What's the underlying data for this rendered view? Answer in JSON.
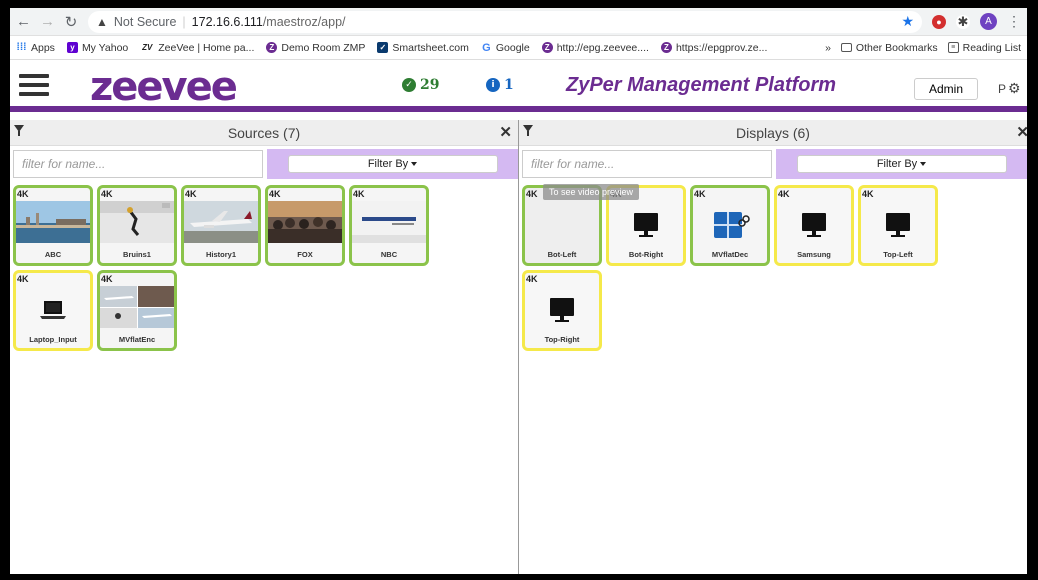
{
  "browser": {
    "not_secure": "Not Secure",
    "url_host": "172.16.6.111",
    "url_path": "/maestroz/app/",
    "profile_initial": "A",
    "bookmarks": [
      {
        "label": "Apps",
        "icon_color": "#1a73e8"
      },
      {
        "label": "My Yahoo",
        "icon_color": "#5f01d1"
      },
      {
        "label": "ZeeVee | Home pa...",
        "icon_color": "#6b2c91"
      },
      {
        "label": "Demo Room ZMP",
        "icon_color": "#6b2c91"
      },
      {
        "label": "Smartsheet.com",
        "icon_color": "#0a3a6e"
      },
      {
        "label": "Google",
        "icon_color": "#4285f4"
      },
      {
        "label": "http://epg.zeevee....",
        "icon_color": "#6b2c91"
      },
      {
        "label": "https://epgprov.ze...",
        "icon_color": "#6b2c91"
      }
    ],
    "more_bookmarks": "»",
    "other_bookmarks": "Other Bookmarks",
    "reading_list": "Reading List"
  },
  "header": {
    "logo": "zeevee",
    "ok_count": "29",
    "info_count": "1",
    "title": "ZyPer Management Platform",
    "admin_label": "Admin",
    "p_label": "P"
  },
  "sources": {
    "title": "Sources (7)",
    "filter_placeholder": "filter for name...",
    "filter_by": "Filter By",
    "items": [
      {
        "badge": "4K",
        "name": "ABC"
      },
      {
        "badge": "4K",
        "name": "Bruins1"
      },
      {
        "badge": "4K",
        "name": "History1"
      },
      {
        "badge": "4K",
        "name": "FOX"
      },
      {
        "badge": "4K",
        "name": "NBC"
      },
      {
        "badge": "4K",
        "name": "Laptop_Input"
      },
      {
        "badge": "4K",
        "name": "MVflatEnc"
      }
    ]
  },
  "displays": {
    "title": "Displays (6)",
    "filter_placeholder": "filter for name...",
    "filter_by": "Filter By",
    "tooltip": "To see video preview",
    "items": [
      {
        "badge": "4K",
        "name": "Bot-Left"
      },
      {
        "badge": "4K",
        "name": "Bot-Right"
      },
      {
        "badge": "4K",
        "name": "MVflatDec"
      },
      {
        "badge": "4K",
        "name": "Samsung"
      },
      {
        "badge": "4K",
        "name": "Top-Left"
      },
      {
        "badge": "4K",
        "name": "Top-Right"
      }
    ]
  },
  "colors": {
    "brand_purple": "#6b2c91",
    "filter_bg": "#d4b9f2",
    "tile_green": "#8bc34a",
    "tile_yellow": "#f5e94a"
  }
}
